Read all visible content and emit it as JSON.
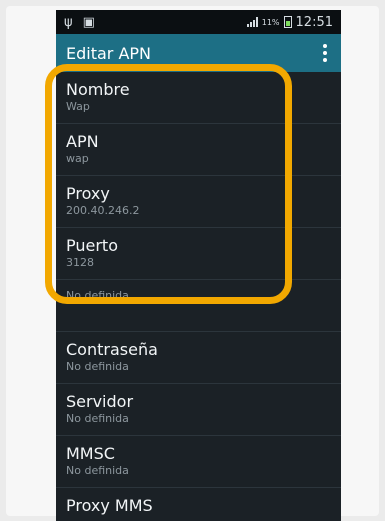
{
  "statusbar": {
    "battery_pct": "11%",
    "time": "12:51",
    "usb_icon": "usb-icon",
    "image_icon": "image-notification-icon"
  },
  "appbar": {
    "title": "Editar APN",
    "menu_icon": "overflow-menu-icon"
  },
  "items": [
    {
      "title": "Nombre",
      "value": "Wap"
    },
    {
      "title": "APN",
      "value": "wap"
    },
    {
      "title": "Proxy",
      "value": "200.40.246.2"
    },
    {
      "title": "Puerto",
      "value": "3128"
    },
    {
      "title": "",
      "value": "No definida"
    },
    {
      "title": "Contraseña",
      "value": "No definida"
    },
    {
      "title": "Servidor",
      "value": "No definida"
    },
    {
      "title": "MMSC",
      "value": "No definida"
    },
    {
      "title": "Proxy MMS",
      "value": ""
    }
  ],
  "colors": {
    "appbar": "#1d6f85",
    "background": "#1b2126",
    "highlight": "#f2a800"
  }
}
